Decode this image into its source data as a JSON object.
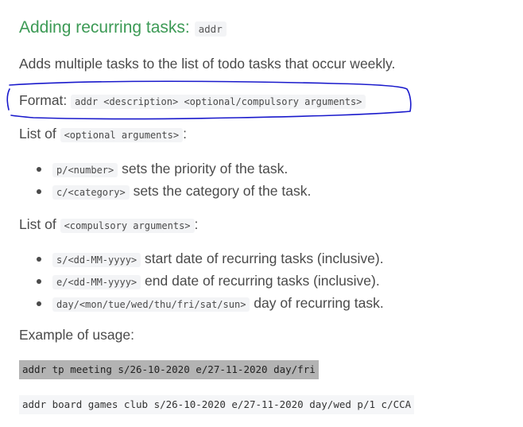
{
  "section": {
    "title": "Adding recurring tasks:",
    "command": "addr"
  },
  "description": "Adds multiple tasks to the list of todo tasks that occur weekly.",
  "format": {
    "label": "Format:",
    "syntax": "addr <description> <optional/compulsory arguments>"
  },
  "optional": {
    "prefix": "List of",
    "code": "<optional arguments>",
    "suffix": ":",
    "items": [
      {
        "code": "p/<number>",
        "text": "sets the priority of the task."
      },
      {
        "code": "c/<category>",
        "text": "sets the category of the task."
      }
    ]
  },
  "compulsory": {
    "prefix": "List of",
    "code": "<compulsory arguments>",
    "suffix": ":",
    "items": [
      {
        "code": "s/<dd-MM-yyyy>",
        "text": "start date of recurring tasks (inclusive)."
      },
      {
        "code": "e/<dd-MM-yyyy>",
        "text": "end date of recurring tasks (inclusive)."
      },
      {
        "code": "day/<mon/tue/wed/thu/fri/sat/sun>",
        "text": "day of recurring task."
      }
    ]
  },
  "examples": {
    "label": "Example of usage:",
    "lines": [
      "addr tp meeting s/26-10-2020 e/27-11-2020 day/fri",
      "addr board games club s/26-10-2020 e/27-11-2020 day/wed p/1 c/CCA"
    ]
  },
  "colors": {
    "heading": "#3c9a55",
    "text": "#4a4a4a",
    "annotation": "#1a1acc",
    "selection": "#b3b3b3"
  }
}
